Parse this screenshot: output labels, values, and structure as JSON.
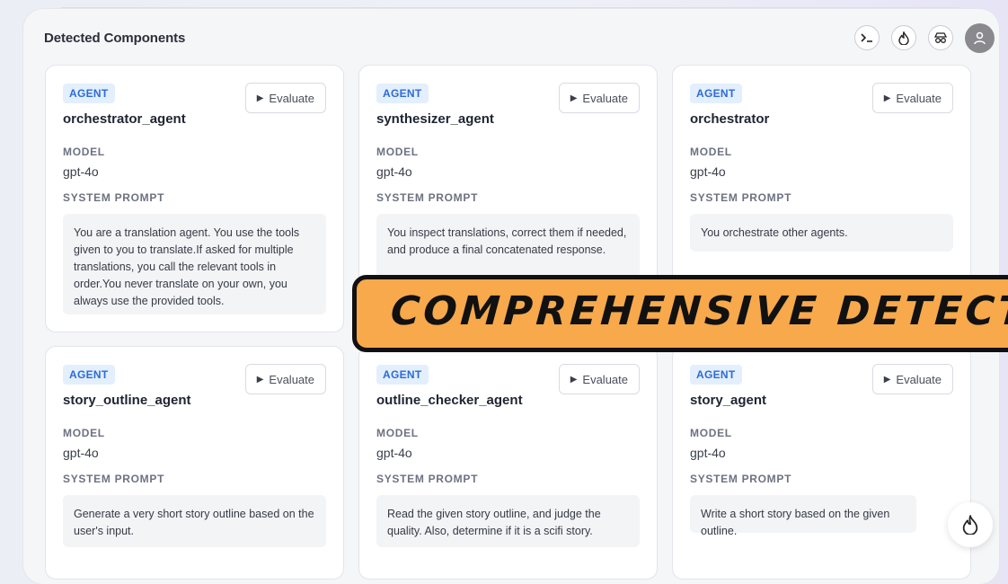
{
  "panel": {
    "title": "Detected Components"
  },
  "top_icons": [
    "terminal-icon",
    "flame-icon",
    "spy-icon",
    "user-avatar-icon"
  ],
  "cards": [
    {
      "badge": "AGENT",
      "evaluate_label": "Evaluate",
      "name": "orchestrator_agent",
      "model_label": "MODEL",
      "model": "gpt-4o",
      "prompt_label": "SYSTEM PROMPT",
      "prompt": "You are a translation agent. You use the tools given to you to translate.If asked for multiple translations, you call the relevant tools in order.You never translate on your own, you always use the provided tools."
    },
    {
      "badge": "AGENT",
      "evaluate_label": "Evaluate",
      "name": "synthesizer_agent",
      "model_label": "MODEL",
      "model": "gpt-4o",
      "prompt_label": "SYSTEM PROMPT",
      "prompt": "You inspect translations, correct them if needed, and produce a final concatenated response."
    },
    {
      "badge": "AGENT",
      "evaluate_label": "Evaluate",
      "name": "orchestrator",
      "model_label": "MODEL",
      "model": "gpt-4o",
      "prompt_label": "SYSTEM PROMPT",
      "prompt": "You orchestrate other agents."
    },
    {
      "badge": "AGENT",
      "evaluate_label": "Evaluate",
      "name": "story_outline_agent",
      "model_label": "MODEL",
      "model": "gpt-4o",
      "prompt_label": "SYSTEM PROMPT",
      "prompt": "Generate a very short story outline based on the user's input."
    },
    {
      "badge": "AGENT",
      "evaluate_label": "Evaluate",
      "name": "outline_checker_agent",
      "model_label": "MODEL",
      "model": "gpt-4o",
      "prompt_label": "SYSTEM PROMPT",
      "prompt": "Read the given story outline, and judge the quality. Also, determine if it is a scifi story."
    },
    {
      "badge": "AGENT",
      "evaluate_label": "Evaluate",
      "name": "story_agent",
      "model_label": "MODEL",
      "model": "gpt-4o",
      "prompt_label": "SYSTEM PROMPT",
      "prompt": "Write a short story based on the given outline."
    }
  ],
  "banner": {
    "text": "COMPREHENSIVE DETECTIO"
  },
  "colors": {
    "badge_bg": "#e3effd",
    "badge_text": "#2c6bd6",
    "banner_bg": "#f7a94b"
  }
}
